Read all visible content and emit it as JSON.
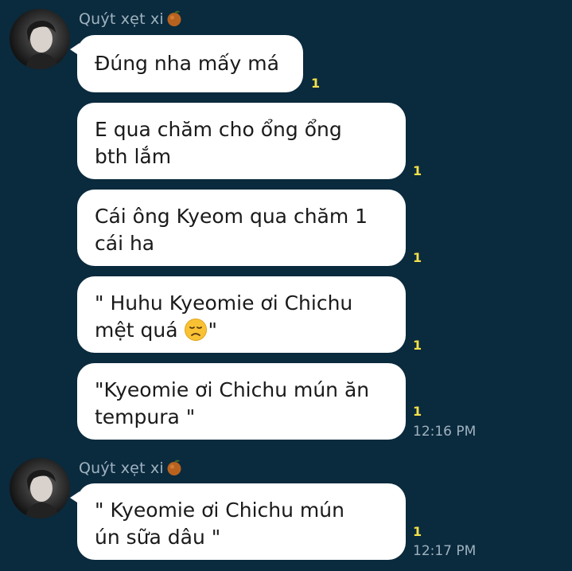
{
  "groups": [
    {
      "sender": "Quýt xẹt xi",
      "sender_emoji": "tangerine-icon",
      "messages": [
        {
          "lines": [
            "Đúng nha mấy má"
          ],
          "unread": "1",
          "time": ""
        },
        {
          "lines": [
            "E qua chăm cho ổng ổng",
            "bth lắm"
          ],
          "unread": "1",
          "time": ""
        },
        {
          "lines": [
            "Cái ông Kyeom qua chăm 1",
            "cái ha"
          ],
          "unread": "1",
          "time": ""
        },
        {
          "lines": [
            "\" Huhu Kyeomie ơi Chichu",
            "mệt quá",
            "\""
          ],
          "unread": "1",
          "time": ""
        },
        {
          "lines": [
            "\"Kyeomie ơi Chichu mún ăn",
            "tempura \""
          ],
          "unread": "1",
          "time": "12:16 PM"
        }
      ]
    },
    {
      "sender": "Quýt xẹt xi",
      "sender_emoji": "tangerine-icon",
      "messages": [
        {
          "lines": [
            "\" Kyeomie ơi Chichu mún",
            "ún sữa dâu \""
          ],
          "unread": "1",
          "time": "12:17 PM"
        }
      ]
    }
  ],
  "colors": {
    "background": "#0a2a3d",
    "bubble": "#ffffff",
    "unread": "#f3e04a",
    "meta_text": "#9fb2bf"
  }
}
